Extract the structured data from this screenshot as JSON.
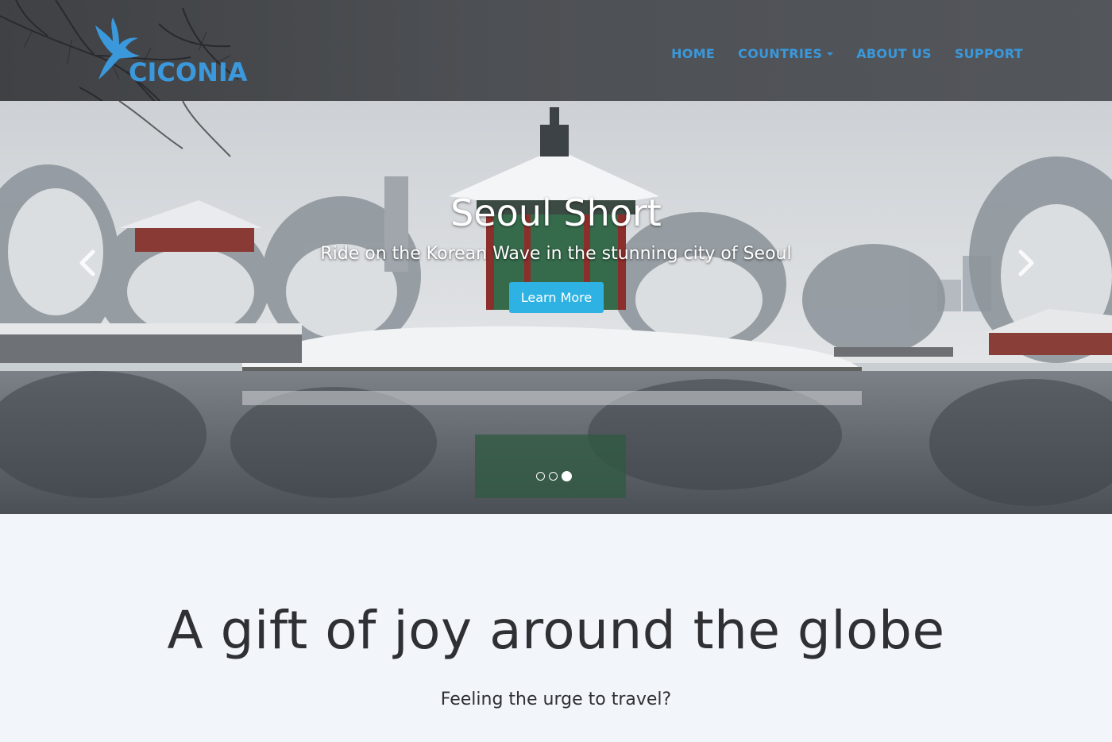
{
  "brand": {
    "name": "CICONIA",
    "logo_icon": "stork-bird-icon",
    "color": "#3a98db"
  },
  "nav": {
    "items": [
      {
        "label": "HOME"
      },
      {
        "label": "COUNTRIES",
        "has_dropdown": true
      },
      {
        "label": "ABOUT US"
      },
      {
        "label": "SUPPORT"
      }
    ]
  },
  "carousel": {
    "title": "Seoul Short",
    "subtitle": "Ride on the Korean Wave in the stunning city of Seoul",
    "button_label": "Learn More",
    "button_color": "#2db2e3",
    "prev_icon": "chevron-left-icon",
    "next_icon": "chevron-right-icon",
    "slide_count": 3,
    "active_slide": 3
  },
  "section": {
    "headline": "A gift of joy around the globe",
    "tagline": "Feeling the urge to travel?"
  }
}
